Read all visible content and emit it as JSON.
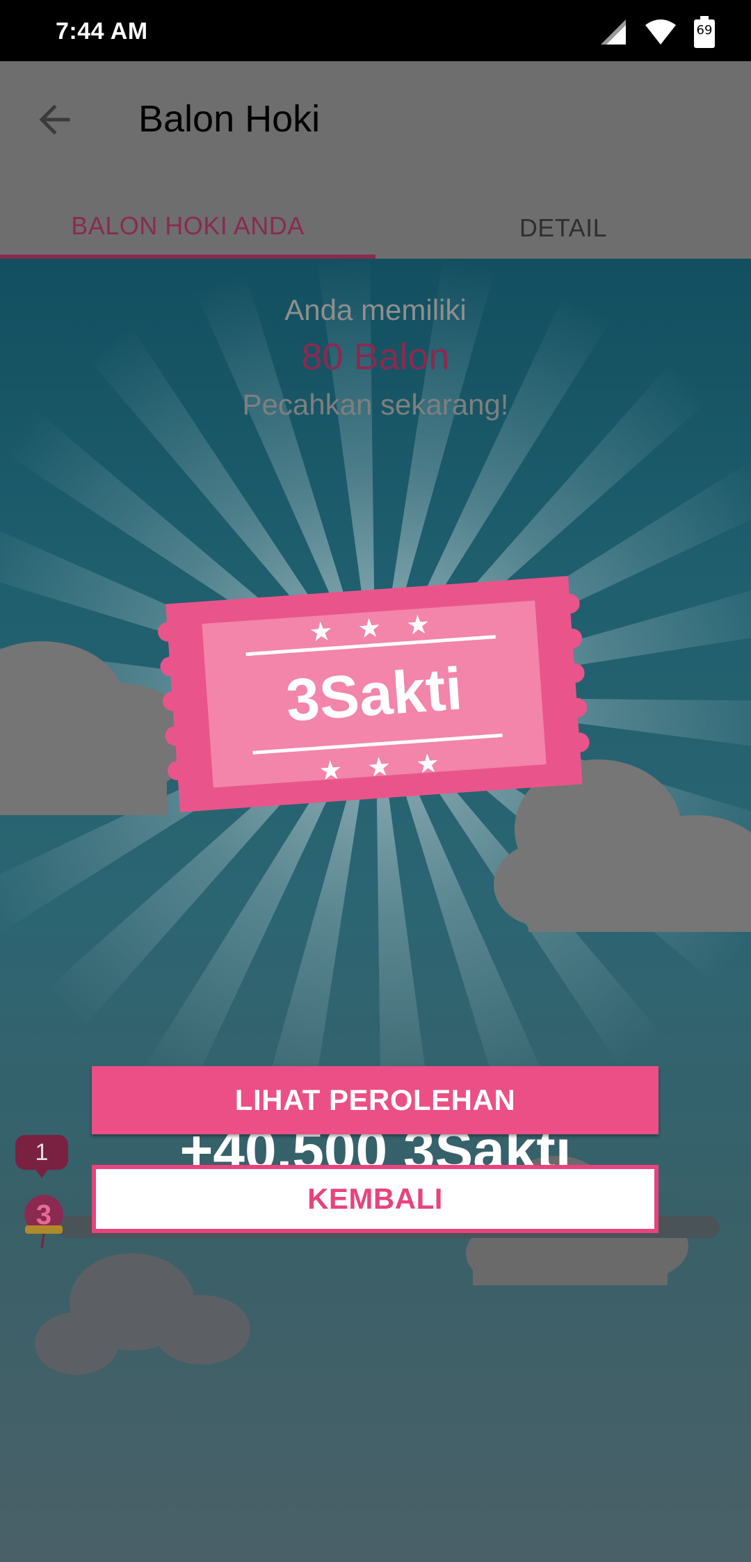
{
  "status_bar": {
    "time": "7:44 AM",
    "battery": "69"
  },
  "app_bar": {
    "title": "Balon Hoki"
  },
  "tabs": [
    {
      "label": "BALON HOKI ANDA",
      "active": true
    },
    {
      "label": "DETAIL",
      "active": false
    }
  ],
  "intro": {
    "line1": "Anda memiliki",
    "balloons": "80 Balon",
    "line3": "Pecahkan sekarang!"
  },
  "ticket": {
    "label": "3Sakti"
  },
  "reward": {
    "text": "+40.500 3Sakti"
  },
  "buttons": {
    "primary": "LIHAT PEROLEHAN",
    "secondary": "KEMBALI"
  },
  "notification": {
    "count": "1"
  },
  "colors": {
    "accent": "#ec4f85",
    "dark_accent": "#8a2a50",
    "sky": "#1f5f6e"
  }
}
